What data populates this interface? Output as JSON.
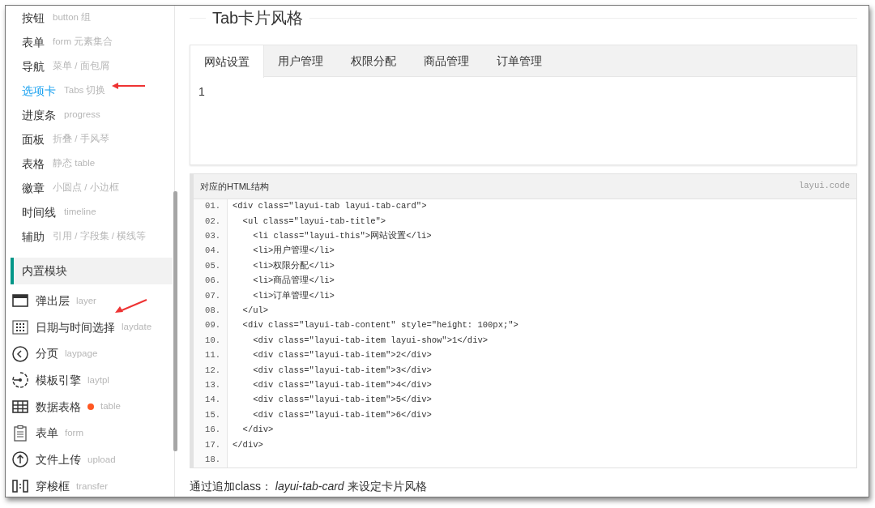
{
  "sidebar": {
    "items": [
      {
        "label": "按钮",
        "hint": "button 组",
        "selected": false
      },
      {
        "label": "表单",
        "hint": "form 元素集合",
        "selected": false
      },
      {
        "label": "导航",
        "hint": "菜单 / 面包屑",
        "selected": false
      },
      {
        "label": "选项卡",
        "hint": "Tabs 切换",
        "selected": true
      },
      {
        "label": "进度条",
        "hint": "progress",
        "selected": false
      },
      {
        "label": "面板",
        "hint": "折叠 / 手风琴",
        "selected": false
      },
      {
        "label": "表格",
        "hint": "静态 table",
        "selected": false
      },
      {
        "label": "徽章",
        "hint": "小圆点 / 小边框",
        "selected": false
      },
      {
        "label": "时间线",
        "hint": "timeline",
        "selected": false
      },
      {
        "label": "辅助",
        "hint": "引用 / 字段集 / 横线等",
        "selected": false
      }
    ],
    "section_title": "内置模块",
    "modules": [
      {
        "label": "弹出层",
        "hint": "layer",
        "kind": "window",
        "dot": false
      },
      {
        "label": "日期与时间选择",
        "hint": "laydate",
        "kind": "calendar",
        "dot": false
      },
      {
        "label": "分页",
        "hint": "laypage",
        "kind": "pager",
        "dot": false
      },
      {
        "label": "模板引擎",
        "hint": "laytpl",
        "kind": "engine",
        "dot": false
      },
      {
        "label": "数据表格",
        "hint": "table",
        "kind": "table",
        "dot": true
      },
      {
        "label": "表单",
        "hint": "form",
        "kind": "form",
        "dot": false
      },
      {
        "label": "文件上传",
        "hint": "upload",
        "kind": "upload",
        "dot": false
      },
      {
        "label": "穿梭框",
        "hint": "transfer",
        "kind": "transfer",
        "dot": false
      }
    ]
  },
  "main": {
    "title": "Tab卡片风格",
    "tabs": [
      {
        "label": "网站设置",
        "selected": true
      },
      {
        "label": "用户管理",
        "selected": false
      },
      {
        "label": "权限分配",
        "selected": false
      },
      {
        "label": "商品管理",
        "selected": false
      },
      {
        "label": "订单管理",
        "selected": false
      }
    ],
    "tab_content": "1",
    "code": {
      "title": "对应的HTML结构",
      "tag": "layui.code",
      "lines": [
        {
          "number": "01.",
          "text": "<div class=\"layui-tab layui-tab-card\">"
        },
        {
          "number": "02.",
          "text": "  <ul class=\"layui-tab-title\">"
        },
        {
          "number": "03.",
          "text": "    <li class=\"layui-this\">网站设置</li>"
        },
        {
          "number": "04.",
          "text": "    <li>用户管理</li>"
        },
        {
          "number": "05.",
          "text": "    <li>权限分配</li>"
        },
        {
          "number": "06.",
          "text": "    <li>商品管理</li>"
        },
        {
          "number": "07.",
          "text": "    <li>订单管理</li>"
        },
        {
          "number": "08.",
          "text": "  </ul>"
        },
        {
          "number": "09.",
          "text": "  <div class=\"layui-tab-content\" style=\"height: 100px;\">"
        },
        {
          "number": "10.",
          "text": "    <div class=\"layui-tab-item layui-show\">1</div>"
        },
        {
          "number": "11.",
          "text": "    <div class=\"layui-tab-item\">2</div>"
        },
        {
          "number": "12.",
          "text": "    <div class=\"layui-tab-item\">3</div>"
        },
        {
          "number": "13.",
          "text": "    <div class=\"layui-tab-item\">4</div>"
        },
        {
          "number": "14.",
          "text": "    <div class=\"layui-tab-item\">5</div>"
        },
        {
          "number": "15.",
          "text": "    <div class=\"layui-tab-item\">6</div>"
        },
        {
          "number": "16.",
          "text": "  </div>"
        },
        {
          "number": "17.",
          "text": "</div>"
        },
        {
          "number": "18."
        }
      ]
    },
    "caption": "通过追加class： *layui-tab-card* 来设定卡片风格"
  }
}
